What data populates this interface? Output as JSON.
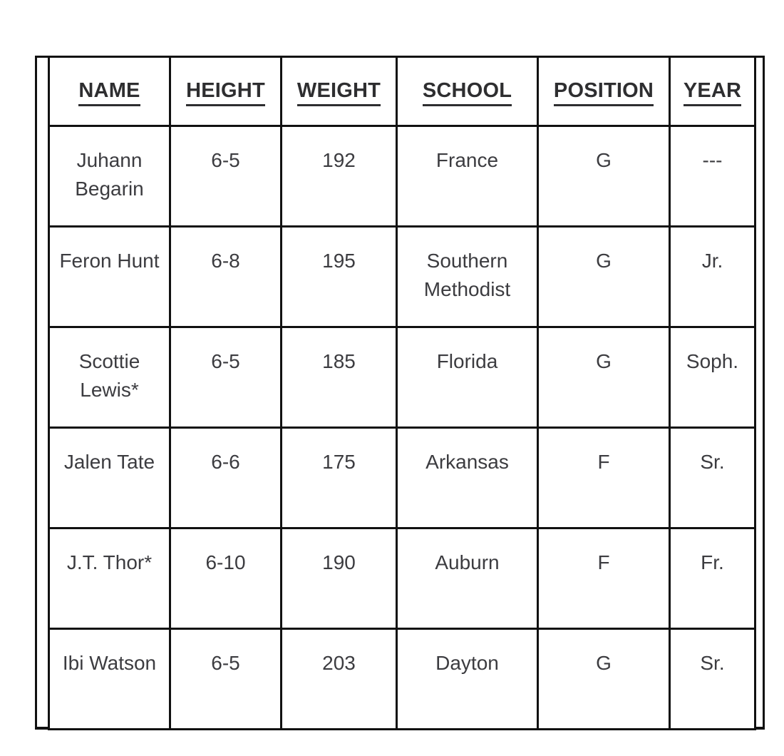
{
  "table": {
    "caption": "",
    "columns": [
      {
        "key": "name",
        "label": "NAME"
      },
      {
        "key": "height",
        "label": "HEIGHT"
      },
      {
        "key": "weight",
        "label": "WEIGHT"
      },
      {
        "key": "school",
        "label": "SCHOOL"
      },
      {
        "key": "position",
        "label": "POSITION"
      },
      {
        "key": "year",
        "label": "YEAR"
      }
    ],
    "rows": [
      {
        "name": "Juhann Begarin",
        "height": "6-5",
        "weight": "192",
        "school": "France",
        "position": "G",
        "year": "---"
      },
      {
        "name": "Feron Hunt",
        "height": "6-8",
        "weight": "195",
        "school": "Southern Methodist",
        "position": "G",
        "year": "Jr."
      },
      {
        "name": "Scottie Lewis*",
        "height": "6-5",
        "weight": "185",
        "school": "Florida",
        "position": "G",
        "year": "Soph."
      },
      {
        "name": "Jalen Tate",
        "height": "6-6",
        "weight": "175",
        "school": "Arkansas",
        "position": "F",
        "year": "Sr."
      },
      {
        "name": "J.T. Thor*",
        "height": "6-10",
        "weight": "190",
        "school": "Auburn",
        "position": "F",
        "year": "Fr."
      },
      {
        "name": "Ibi Watson",
        "height": "6-5",
        "weight": "203",
        "school": "Dayton",
        "position": "G",
        "year": "Sr."
      }
    ]
  },
  "colors": {
    "border": "#111111",
    "header_text": "#2e2e30",
    "body_text": "#3c3c40",
    "background": "#ffffff"
  }
}
